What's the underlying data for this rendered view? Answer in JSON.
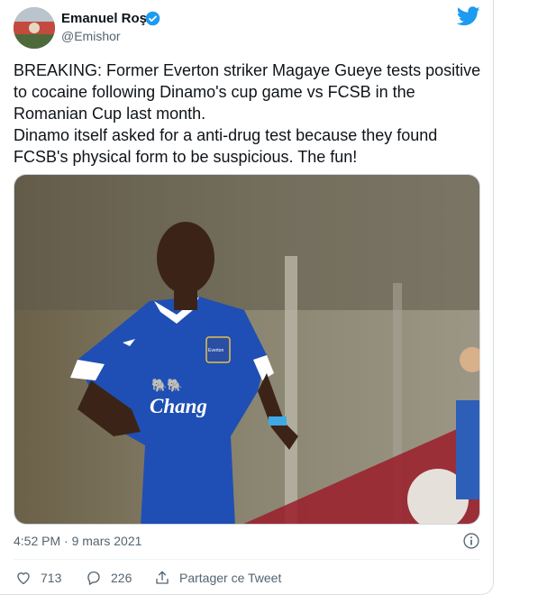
{
  "tweet": {
    "author_name": "Emanuel Roşu",
    "author_handle": "@Emishor",
    "text": "BREAKING: Former Everton striker Magaye Gueye tests positive to cocaine following Dinamo's cup game vs FCSB in the Romanian Cup last month.\nDinamo itself asked for a anti-drug test because they found FCSB's physical form to be suspicious. The fun!",
    "timestamp": "4:52 PM · 9 mars 2021",
    "media": {
      "shirt_sponsor": "Chang",
      "badge_text": "Everton"
    }
  },
  "actions": {
    "likes": "713",
    "replies": "226",
    "share_label": "Partager ce Tweet"
  },
  "colors": {
    "twitter_blue": "#1d9bf0",
    "everton_blue": "#1f4fb4",
    "secondary_text": "#536471"
  },
  "icons": [
    "avatar",
    "verified-badge-icon",
    "twitter-bird-icon",
    "info-icon",
    "heart-icon",
    "reply-icon",
    "share-icon"
  ]
}
